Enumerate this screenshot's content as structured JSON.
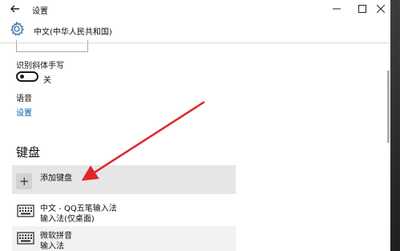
{
  "titlebar": {
    "title": "设置"
  },
  "header": {
    "language_title": "中文(中华人民共和国)"
  },
  "handwriting": {
    "label": "识别斜体手写",
    "toggle_state": "关"
  },
  "voice": {
    "label": "语音",
    "link": "设置"
  },
  "keyboard": {
    "heading": "键盘",
    "add_label": "添加键盘",
    "items": [
      {
        "name": "中文 - QQ五笔输入法",
        "subtitle": "输入法(仅桌面)"
      },
      {
        "name": "微软拼音",
        "subtitle": "输入法"
      }
    ]
  },
  "colors": {
    "link": "#0063b1",
    "annotation_arrow": "#e0262b",
    "selected_bg": "#e6e6e6"
  },
  "icons": {
    "back": "back-arrow-icon",
    "minimize": "minimize-icon",
    "maximize": "maximize-icon",
    "close": "close-icon",
    "gear": "gear-icon",
    "plus": "plus-icon",
    "keyboard": "keyboard-icon"
  }
}
